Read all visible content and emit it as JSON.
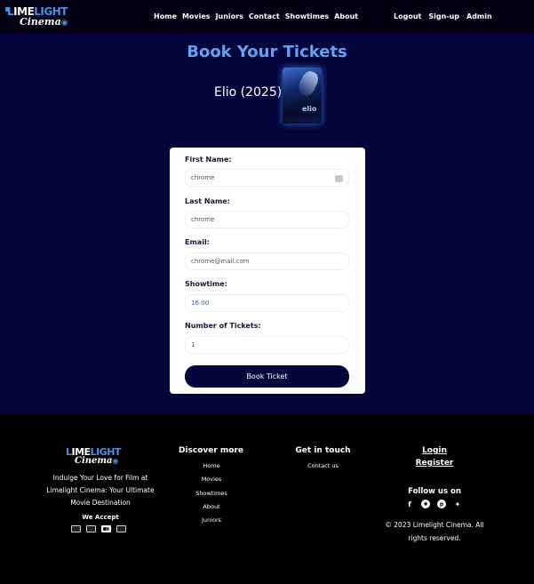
{
  "nav": {
    "logo": {
      "line1_a": "L",
      "line1_b": "IME",
      "line1_c": "LIGHT",
      "line2": "Cinema"
    },
    "links": [
      "Home",
      "Movies",
      "Juniors",
      "Contact",
      "Showtimes",
      "About"
    ],
    "right_links": [
      "Logout",
      "Sign-up",
      "Admin"
    ]
  },
  "page": {
    "title": "Book Your Tickets",
    "movie_title": "Elio (2025)",
    "poster_text": "elio"
  },
  "form": {
    "first_name_label": "First Name:",
    "first_name_value": "chrome",
    "last_name_label": "Last Name:",
    "last_name_value": "chrome",
    "email_label": "Email:",
    "email_value": "chrome@mail.com",
    "showtime_label": "Showtime:",
    "showtime_value": "16:00",
    "tickets_label": "Number of Tickets:",
    "tickets_value": "1",
    "submit_label": "Book Ticket"
  },
  "footer": {
    "logo": {
      "line1_a": "L",
      "line1_b": "IME",
      "line1_c": "LIGHT",
      "line2": "Cinema"
    },
    "tagline": "Indulge Your Love for Film at Limelight Cinema: Your Ultimate Movie Destination",
    "accept_label": "We Accept",
    "payment_icons": [
      "visa-card-icon",
      "credit-card-icon",
      "mastercard-icon",
      "amex-card-icon"
    ],
    "discover_heading": "Discover more",
    "discover_links": [
      "Home",
      "Movies",
      "Showtimes",
      "About",
      "Juniors"
    ],
    "touch_heading": "Get in touch",
    "touch_links": [
      "Contact us"
    ],
    "login_label": "Login",
    "register_label": "Register",
    "follow_heading": "Follow us on",
    "social_icons": [
      "facebook-icon",
      "dribbble-icon",
      "pinterest-icon",
      "twitter-icon"
    ],
    "copyright": "© 2023 Limelight Cinema. All rights reserved."
  },
  "colors": {
    "page_bg": "#04053a",
    "nav_bg": "#020214",
    "accent": "#63a0f2",
    "button_bg": "#04053a",
    "footer_bg": "#000000"
  }
}
